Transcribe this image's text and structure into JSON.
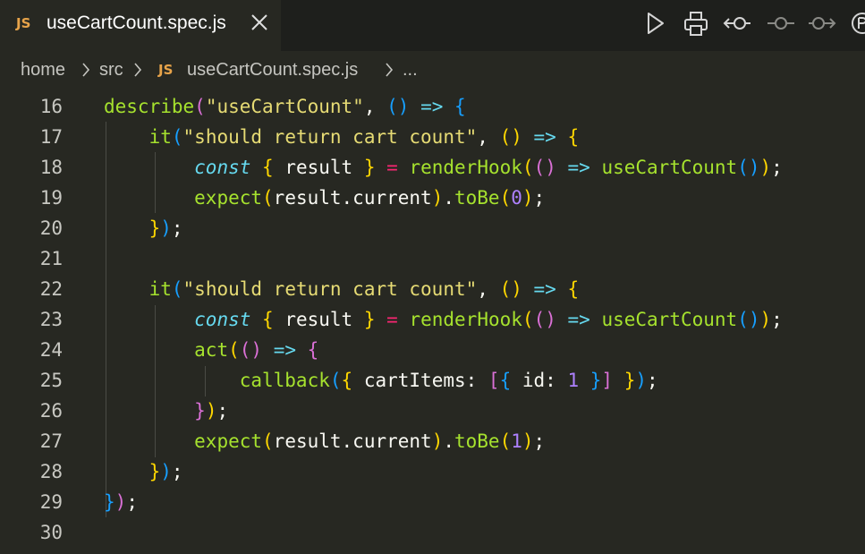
{
  "tab": {
    "language_badge": "JS",
    "filename": "useCartCount.spec.js"
  },
  "toolbar": {
    "actions": [
      {
        "name": "run-icon"
      },
      {
        "name": "print-icon"
      },
      {
        "name": "previous-change-icon"
      },
      {
        "name": "current-change-icon"
      },
      {
        "name": "next-change-icon"
      },
      {
        "name": "more-icon"
      }
    ]
  },
  "breadcrumb": {
    "items": [
      "home",
      "src",
      "useCartCount.spec.js",
      "..."
    ],
    "file_badge": "JS"
  },
  "editor": {
    "line_numbers": [
      "16",
      "17",
      "18",
      "19",
      "20",
      "21",
      "22",
      "23",
      "24",
      "25",
      "26",
      "27",
      "28",
      "29",
      "30"
    ],
    "lines": [
      {
        "n": "16",
        "tokens": [
          {
            "t": "describe",
            "c": "fn"
          },
          {
            "t": "(",
            "c": "p2"
          },
          {
            "t": "\"useCartCount\"",
            "c": "str"
          },
          {
            "t": ", ",
            "c": "plain"
          },
          {
            "t": "()",
            "c": "p3"
          },
          {
            "t": " ",
            "c": "plain"
          },
          {
            "t": "=>",
            "c": "arrow"
          },
          {
            "t": " ",
            "c": "plain"
          },
          {
            "t": "{",
            "c": "p3"
          }
        ]
      },
      {
        "n": "17",
        "tokens": [
          {
            "t": "    ",
            "c": "plain"
          },
          {
            "t": "it",
            "c": "fn"
          },
          {
            "t": "(",
            "c": "p3"
          },
          {
            "t": "\"should return cart count\"",
            "c": "str"
          },
          {
            "t": ", ",
            "c": "plain"
          },
          {
            "t": "()",
            "c": "p1"
          },
          {
            "t": " ",
            "c": "plain"
          },
          {
            "t": "=>",
            "c": "arrow"
          },
          {
            "t": " ",
            "c": "plain"
          },
          {
            "t": "{",
            "c": "p1"
          }
        ]
      },
      {
        "n": "18",
        "tokens": [
          {
            "t": "        ",
            "c": "plain"
          },
          {
            "t": "const",
            "c": "kw"
          },
          {
            "t": " ",
            "c": "plain"
          },
          {
            "t": "{",
            "c": "p1"
          },
          {
            "t": " result ",
            "c": "plain"
          },
          {
            "t": "}",
            "c": "p1"
          },
          {
            "t": " ",
            "c": "plain"
          },
          {
            "t": "=",
            "c": "op"
          },
          {
            "t": " ",
            "c": "plain"
          },
          {
            "t": "renderHook",
            "c": "fn"
          },
          {
            "t": "(",
            "c": "p1"
          },
          {
            "t": "()",
            "c": "p2"
          },
          {
            "t": " ",
            "c": "plain"
          },
          {
            "t": "=>",
            "c": "arrow"
          },
          {
            "t": " ",
            "c": "plain"
          },
          {
            "t": "useCartCount",
            "c": "fn"
          },
          {
            "t": "()",
            "c": "p3"
          },
          {
            "t": ")",
            "c": "p1"
          },
          {
            "t": ";",
            "c": "plain"
          }
        ]
      },
      {
        "n": "19",
        "tokens": [
          {
            "t": "        ",
            "c": "plain"
          },
          {
            "t": "expect",
            "c": "fn"
          },
          {
            "t": "(",
            "c": "p1"
          },
          {
            "t": "result.current",
            "c": "plain"
          },
          {
            "t": ")",
            "c": "p1"
          },
          {
            "t": ".",
            "c": "plain"
          },
          {
            "t": "toBe",
            "c": "fn"
          },
          {
            "t": "(",
            "c": "p1"
          },
          {
            "t": "0",
            "c": "num"
          },
          {
            "t": ")",
            "c": "p1"
          },
          {
            "t": ";",
            "c": "plain"
          }
        ]
      },
      {
        "n": "20",
        "tokens": [
          {
            "t": "    ",
            "c": "plain"
          },
          {
            "t": "}",
            "c": "p1"
          },
          {
            "t": ")",
            "c": "p3"
          },
          {
            "t": ";",
            "c": "plain"
          }
        ]
      },
      {
        "n": "21",
        "tokens": []
      },
      {
        "n": "22",
        "tokens": [
          {
            "t": "    ",
            "c": "plain"
          },
          {
            "t": "it",
            "c": "fn"
          },
          {
            "t": "(",
            "c": "p3"
          },
          {
            "t": "\"should return cart count\"",
            "c": "str"
          },
          {
            "t": ", ",
            "c": "plain"
          },
          {
            "t": "()",
            "c": "p1"
          },
          {
            "t": " ",
            "c": "plain"
          },
          {
            "t": "=>",
            "c": "arrow"
          },
          {
            "t": " ",
            "c": "plain"
          },
          {
            "t": "{",
            "c": "p1"
          }
        ]
      },
      {
        "n": "23",
        "tokens": [
          {
            "t": "        ",
            "c": "plain"
          },
          {
            "t": "const",
            "c": "kw"
          },
          {
            "t": " ",
            "c": "plain"
          },
          {
            "t": "{",
            "c": "p1"
          },
          {
            "t": " result ",
            "c": "plain"
          },
          {
            "t": "}",
            "c": "p1"
          },
          {
            "t": " ",
            "c": "plain"
          },
          {
            "t": "=",
            "c": "op"
          },
          {
            "t": " ",
            "c": "plain"
          },
          {
            "t": "renderHook",
            "c": "fn"
          },
          {
            "t": "(",
            "c": "p1"
          },
          {
            "t": "()",
            "c": "p2"
          },
          {
            "t": " ",
            "c": "plain"
          },
          {
            "t": "=>",
            "c": "arrow"
          },
          {
            "t": " ",
            "c": "plain"
          },
          {
            "t": "useCartCount",
            "c": "fn"
          },
          {
            "t": "()",
            "c": "p3"
          },
          {
            "t": ")",
            "c": "p1"
          },
          {
            "t": ";",
            "c": "plain"
          }
        ]
      },
      {
        "n": "24",
        "tokens": [
          {
            "t": "        ",
            "c": "plain"
          },
          {
            "t": "act",
            "c": "fn"
          },
          {
            "t": "(",
            "c": "p1"
          },
          {
            "t": "()",
            "c": "p2"
          },
          {
            "t": " ",
            "c": "plain"
          },
          {
            "t": "=>",
            "c": "arrow"
          },
          {
            "t": " ",
            "c": "plain"
          },
          {
            "t": "{",
            "c": "p2"
          }
        ]
      },
      {
        "n": "25",
        "tokens": [
          {
            "t": "            ",
            "c": "plain"
          },
          {
            "t": "callback",
            "c": "fn"
          },
          {
            "t": "(",
            "c": "p3"
          },
          {
            "t": "{",
            "c": "p1"
          },
          {
            "t": " cartItems: ",
            "c": "plain"
          },
          {
            "t": "[",
            "c": "p2"
          },
          {
            "t": "{",
            "c": "p3"
          },
          {
            "t": " id: ",
            "c": "plain"
          },
          {
            "t": "1",
            "c": "num"
          },
          {
            "t": " ",
            "c": "plain"
          },
          {
            "t": "}",
            "c": "p3"
          },
          {
            "t": "]",
            "c": "p2"
          },
          {
            "t": " ",
            "c": "plain"
          },
          {
            "t": "}",
            "c": "p1"
          },
          {
            "t": ")",
            "c": "p3"
          },
          {
            "t": ";",
            "c": "plain"
          }
        ]
      },
      {
        "n": "26",
        "tokens": [
          {
            "t": "        ",
            "c": "plain"
          },
          {
            "t": "}",
            "c": "p2"
          },
          {
            "t": ")",
            "c": "p1"
          },
          {
            "t": ";",
            "c": "plain"
          }
        ]
      },
      {
        "n": "27",
        "tokens": [
          {
            "t": "        ",
            "c": "plain"
          },
          {
            "t": "expect",
            "c": "fn"
          },
          {
            "t": "(",
            "c": "p1"
          },
          {
            "t": "result.current",
            "c": "plain"
          },
          {
            "t": ")",
            "c": "p1"
          },
          {
            "t": ".",
            "c": "plain"
          },
          {
            "t": "toBe",
            "c": "fn"
          },
          {
            "t": "(",
            "c": "p1"
          },
          {
            "t": "1",
            "c": "num"
          },
          {
            "t": ")",
            "c": "p1"
          },
          {
            "t": ";",
            "c": "plain"
          }
        ]
      },
      {
        "n": "28",
        "tokens": [
          {
            "t": "    ",
            "c": "plain"
          },
          {
            "t": "}",
            "c": "p1"
          },
          {
            "t": ")",
            "c": "p3"
          },
          {
            "t": ";",
            "c": "plain"
          }
        ]
      },
      {
        "n": "29",
        "tokens": [
          {
            "t": "}",
            "c": "p3"
          },
          {
            "t": ")",
            "c": "p2"
          },
          {
            "t": ";",
            "c": "plain"
          }
        ]
      },
      {
        "n": "30",
        "tokens": []
      }
    ]
  },
  "colors": {
    "background": "#272822",
    "tabbar": "#1e1f1c",
    "function": "#a6e22e",
    "string": "#e6db74",
    "keyword": "#66d9ef",
    "number": "#ae81ff",
    "operator": "#f92672",
    "bracket_gold": "#ffd700",
    "bracket_orchid": "#da70d6",
    "bracket_blue": "#179fff",
    "js_badge": "#e8a44a"
  }
}
